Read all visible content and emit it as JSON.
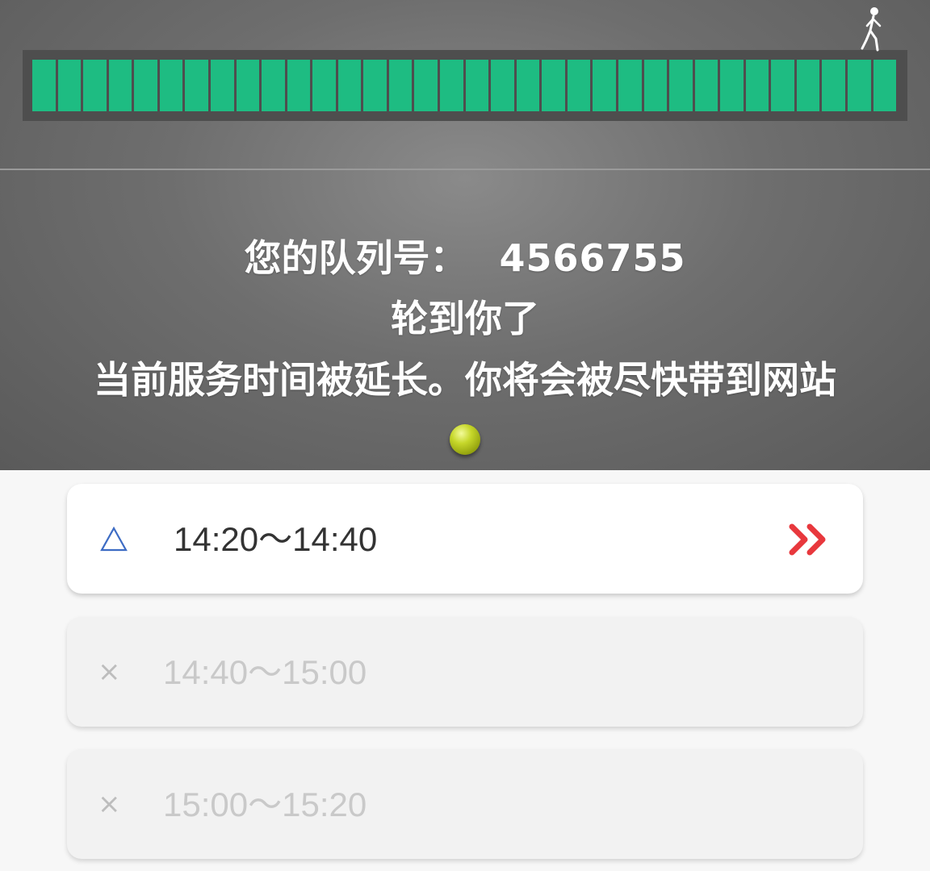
{
  "queue": {
    "label": "您的队列号：",
    "number": "4566755",
    "turn_message": "轮到你了",
    "notice": "当前服务时间被延长。你将会被尽快带到网站",
    "progress": 1.0,
    "segment_count": 34
  },
  "slots": [
    {
      "status": "available",
      "icon": "triangle-icon",
      "time": "14:20～14:40",
      "action_icon": "double-chevron-right-icon"
    },
    {
      "status": "full",
      "icon": "x-icon",
      "symbol": "×",
      "time": "14:40～15:00"
    },
    {
      "status": "full",
      "icon": "x-icon",
      "symbol": "×",
      "time": "15:00～15:20"
    }
  ],
  "colors": {
    "progress": "#1ebc82",
    "available_icon": "#3d6cc4",
    "action": "#e8383d",
    "disabled_text": "#c9c9c9"
  }
}
